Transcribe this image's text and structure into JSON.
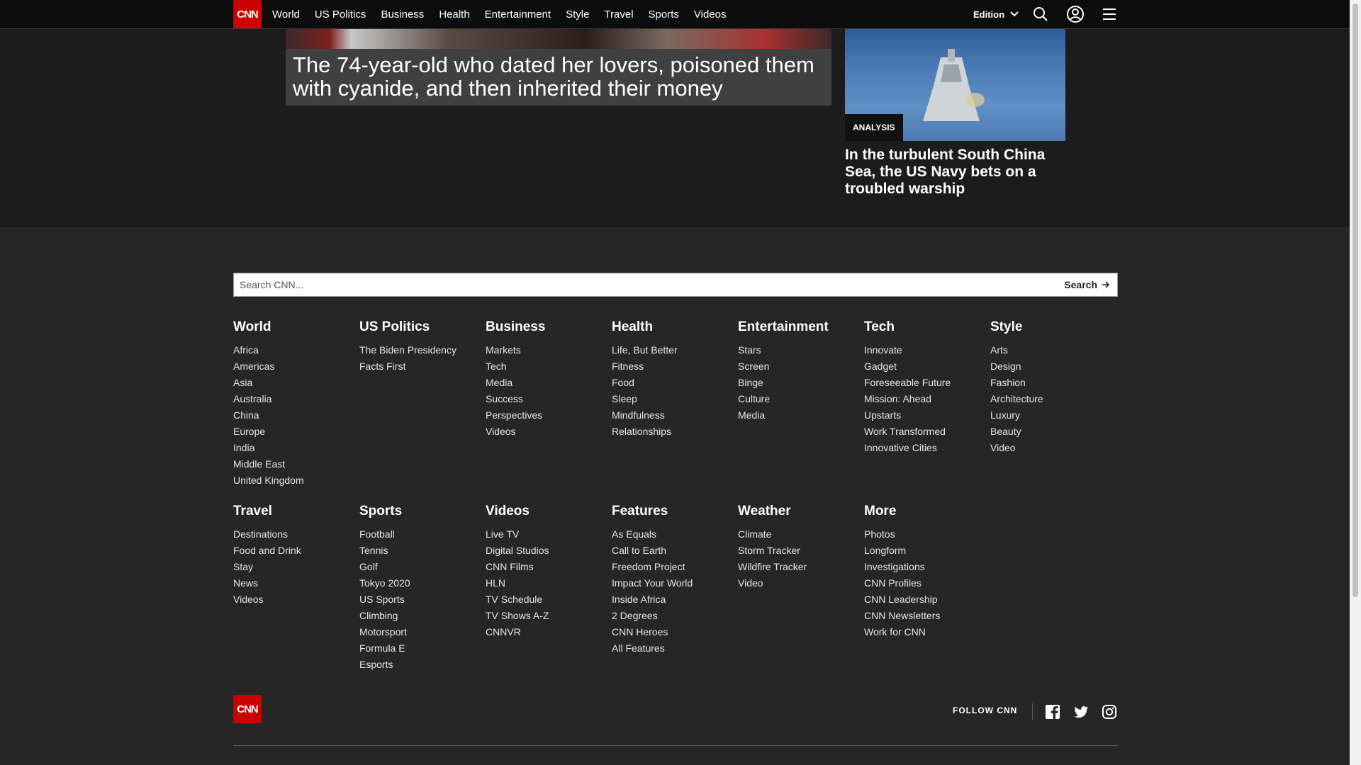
{
  "nav": {
    "logo": "CNN",
    "links": [
      "World",
      "US Politics",
      "Business",
      "Health",
      "Entertainment",
      "Style",
      "Travel",
      "Sports",
      "Videos"
    ],
    "edition_label": "Edition"
  },
  "hero": {
    "main_headline": "The 74-year-old who dated her lovers, poisoned them with cyanide, and then inherited their money",
    "side_badge": "ANALYSIS",
    "side_headline": "In the turbulent South China Sea, the US Navy bets on a troubled warship"
  },
  "search": {
    "placeholder": "Search CNN...",
    "button_label": "Search"
  },
  "footer_columns_row1": [
    {
      "title": "World",
      "items": [
        "Africa",
        "Americas",
        "Asia",
        "Australia",
        "China",
        "Europe",
        "India",
        "Middle East",
        "United Kingdom"
      ]
    },
    {
      "title": "US Politics",
      "items": [
        "The Biden Presidency",
        "Facts First"
      ]
    },
    {
      "title": "Business",
      "items": [
        "Markets",
        "Tech",
        "Media",
        "Success",
        "Perspectives",
        "Videos"
      ]
    },
    {
      "title": "Health",
      "items": [
        "Life, But Better",
        "Fitness",
        "Food",
        "Sleep",
        "Mindfulness",
        "Relationships"
      ]
    },
    {
      "title": "Entertainment",
      "items": [
        "Stars",
        "Screen",
        "Binge",
        "Culture",
        "Media"
      ]
    },
    {
      "title": "Tech",
      "items": [
        "Innovate",
        "Gadget",
        "Foreseeable Future",
        "Mission: Ahead",
        "Upstarts",
        "Work Transformed",
        "Innovative Cities"
      ]
    },
    {
      "title": "Style",
      "items": [
        "Arts",
        "Design",
        "Fashion",
        "Architecture",
        "Luxury",
        "Beauty",
        "Video"
      ]
    }
  ],
  "footer_columns_row2": [
    {
      "title": "Travel",
      "items": [
        "Destinations",
        "Food and Drink",
        "Stay",
        "News",
        "Videos"
      ]
    },
    {
      "title": "Sports",
      "items": [
        "Football",
        "Tennis",
        "Golf",
        "Tokyo 2020",
        "US Sports",
        "Climbing",
        "Motorsport",
        "Formula E",
        "Esports"
      ]
    },
    {
      "title": "Videos",
      "items": [
        "Live TV",
        "Digital Studios",
        "CNN Films",
        "HLN",
        "TV Schedule",
        "TV Shows A-Z",
        "CNNVR"
      ]
    },
    {
      "title": "Features",
      "items": [
        "As Equals",
        "Call to Earth",
        "Freedom Project",
        "Impact Your World",
        "Inside Africa",
        "2 Degrees",
        "CNN Heroes",
        "All Features"
      ]
    },
    {
      "title": "Weather",
      "items": [
        "Climate",
        "Storm Tracker",
        "Wildfire Tracker",
        "Video"
      ]
    },
    {
      "title": "More",
      "items": [
        "Photos",
        "Longform",
        "Investigations",
        "CNN Profiles",
        "CNN Leadership",
        "CNN Newsletters",
        "Work for CNN"
      ]
    }
  ],
  "bottom": {
    "logo": "CNN",
    "follow_label": "FOLLOW CNN",
    "social_icons": [
      "facebook-icon",
      "twitter-icon",
      "instagram-icon"
    ]
  },
  "colors": {
    "brand_red": "#cc0000",
    "footer_bg": "#262626",
    "nav_bg": "#0c0c0c"
  }
}
